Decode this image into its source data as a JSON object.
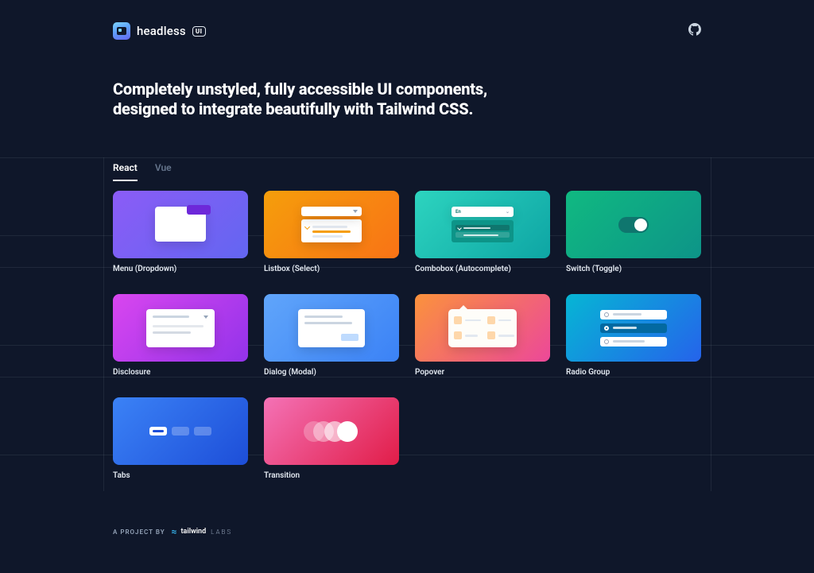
{
  "brand": {
    "name": "headless",
    "badge": "UI"
  },
  "hero_line1": "Completely unstyled, fully accessible UI components,",
  "hero_line2": "designed to integrate beautifully with Tailwind CSS.",
  "tabs": [
    {
      "label": "React",
      "active": true
    },
    {
      "label": "Vue",
      "active": false
    }
  ],
  "components": [
    {
      "key": "menu",
      "label": "Menu (Dropdown)"
    },
    {
      "key": "listbox",
      "label": "Listbox (Select)"
    },
    {
      "key": "combobox",
      "label": "Combobox (Autocomplete)",
      "sample_text": "En"
    },
    {
      "key": "switch",
      "label": "Switch (Toggle)"
    },
    {
      "key": "disclosure",
      "label": "Disclosure"
    },
    {
      "key": "dialog",
      "label": "Dialog (Modal)"
    },
    {
      "key": "popover",
      "label": "Popover"
    },
    {
      "key": "radio",
      "label": "Radio Group"
    },
    {
      "key": "tabs",
      "label": "Tabs"
    },
    {
      "key": "transition",
      "label": "Transition"
    }
  ],
  "footer": {
    "prefix": "A PROJECT BY",
    "brand": "tailwind",
    "suffix": "LABS"
  }
}
